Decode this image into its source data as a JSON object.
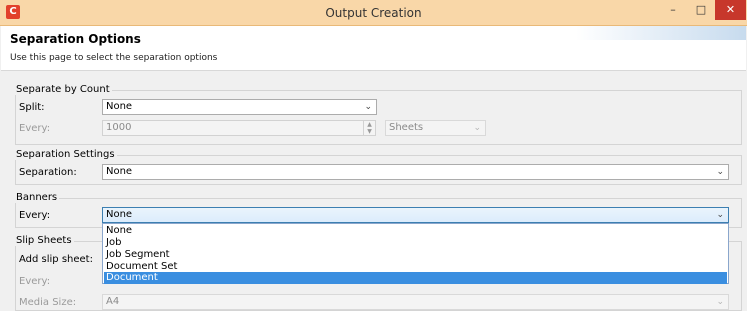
{
  "window": {
    "title": "Output Creation",
    "app_icon": "C",
    "minimize": "–",
    "maximize": "□",
    "close": "✕"
  },
  "header": {
    "title": "Separation Options",
    "subtitle": "Use this page to select the separation options"
  },
  "separate_by_count": {
    "title": "Separate by Count",
    "split_label": "Split:",
    "split_value": "None",
    "every_label": "Every:",
    "every_value": "1000",
    "unit_value": "Sheets"
  },
  "separation_settings": {
    "title": "Separation Settings",
    "separation_label": "Separation:",
    "separation_value": "None"
  },
  "banners": {
    "title": "Banners",
    "every_label": "Every:",
    "every_value": "None",
    "options": [
      "None",
      "Job",
      "Job Segment",
      "Document Set",
      "Document"
    ],
    "highlighted_option": "Document"
  },
  "slip_sheets": {
    "title": "Slip Sheets",
    "add_label": "Add slip sheet:",
    "every_label": "Every:",
    "media_label": "Media Size:",
    "media_value": "A4"
  },
  "icons": {
    "chevron": "⌄",
    "spin_up": "▲",
    "spin_down": "▼"
  }
}
